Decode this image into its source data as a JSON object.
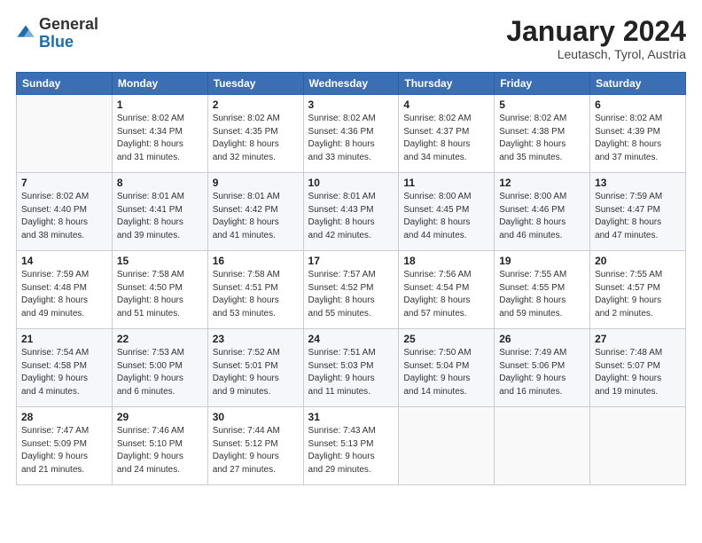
{
  "header": {
    "logo_general": "General",
    "logo_blue": "Blue",
    "month_title": "January 2024",
    "location": "Leutasch, Tyrol, Austria"
  },
  "days_of_week": [
    "Sunday",
    "Monday",
    "Tuesday",
    "Wednesday",
    "Thursday",
    "Friday",
    "Saturday"
  ],
  "weeks": [
    [
      {
        "day": "",
        "detail": ""
      },
      {
        "day": "1",
        "detail": "Sunrise: 8:02 AM\nSunset: 4:34 PM\nDaylight: 8 hours\nand 31 minutes."
      },
      {
        "day": "2",
        "detail": "Sunrise: 8:02 AM\nSunset: 4:35 PM\nDaylight: 8 hours\nand 32 minutes."
      },
      {
        "day": "3",
        "detail": "Sunrise: 8:02 AM\nSunset: 4:36 PM\nDaylight: 8 hours\nand 33 minutes."
      },
      {
        "day": "4",
        "detail": "Sunrise: 8:02 AM\nSunset: 4:37 PM\nDaylight: 8 hours\nand 34 minutes."
      },
      {
        "day": "5",
        "detail": "Sunrise: 8:02 AM\nSunset: 4:38 PM\nDaylight: 8 hours\nand 35 minutes."
      },
      {
        "day": "6",
        "detail": "Sunrise: 8:02 AM\nSunset: 4:39 PM\nDaylight: 8 hours\nand 37 minutes."
      }
    ],
    [
      {
        "day": "7",
        "detail": "Sunrise: 8:02 AM\nSunset: 4:40 PM\nDaylight: 8 hours\nand 38 minutes."
      },
      {
        "day": "8",
        "detail": "Sunrise: 8:01 AM\nSunset: 4:41 PM\nDaylight: 8 hours\nand 39 minutes."
      },
      {
        "day": "9",
        "detail": "Sunrise: 8:01 AM\nSunset: 4:42 PM\nDaylight: 8 hours\nand 41 minutes."
      },
      {
        "day": "10",
        "detail": "Sunrise: 8:01 AM\nSunset: 4:43 PM\nDaylight: 8 hours\nand 42 minutes."
      },
      {
        "day": "11",
        "detail": "Sunrise: 8:00 AM\nSunset: 4:45 PM\nDaylight: 8 hours\nand 44 minutes."
      },
      {
        "day": "12",
        "detail": "Sunrise: 8:00 AM\nSunset: 4:46 PM\nDaylight: 8 hours\nand 46 minutes."
      },
      {
        "day": "13",
        "detail": "Sunrise: 7:59 AM\nSunset: 4:47 PM\nDaylight: 8 hours\nand 47 minutes."
      }
    ],
    [
      {
        "day": "14",
        "detail": "Sunrise: 7:59 AM\nSunset: 4:48 PM\nDaylight: 8 hours\nand 49 minutes."
      },
      {
        "day": "15",
        "detail": "Sunrise: 7:58 AM\nSunset: 4:50 PM\nDaylight: 8 hours\nand 51 minutes."
      },
      {
        "day": "16",
        "detail": "Sunrise: 7:58 AM\nSunset: 4:51 PM\nDaylight: 8 hours\nand 53 minutes."
      },
      {
        "day": "17",
        "detail": "Sunrise: 7:57 AM\nSunset: 4:52 PM\nDaylight: 8 hours\nand 55 minutes."
      },
      {
        "day": "18",
        "detail": "Sunrise: 7:56 AM\nSunset: 4:54 PM\nDaylight: 8 hours\nand 57 minutes."
      },
      {
        "day": "19",
        "detail": "Sunrise: 7:55 AM\nSunset: 4:55 PM\nDaylight: 8 hours\nand 59 minutes."
      },
      {
        "day": "20",
        "detail": "Sunrise: 7:55 AM\nSunset: 4:57 PM\nDaylight: 9 hours\nand 2 minutes."
      }
    ],
    [
      {
        "day": "21",
        "detail": "Sunrise: 7:54 AM\nSunset: 4:58 PM\nDaylight: 9 hours\nand 4 minutes."
      },
      {
        "day": "22",
        "detail": "Sunrise: 7:53 AM\nSunset: 5:00 PM\nDaylight: 9 hours\nand 6 minutes."
      },
      {
        "day": "23",
        "detail": "Sunrise: 7:52 AM\nSunset: 5:01 PM\nDaylight: 9 hours\nand 9 minutes."
      },
      {
        "day": "24",
        "detail": "Sunrise: 7:51 AM\nSunset: 5:03 PM\nDaylight: 9 hours\nand 11 minutes."
      },
      {
        "day": "25",
        "detail": "Sunrise: 7:50 AM\nSunset: 5:04 PM\nDaylight: 9 hours\nand 14 minutes."
      },
      {
        "day": "26",
        "detail": "Sunrise: 7:49 AM\nSunset: 5:06 PM\nDaylight: 9 hours\nand 16 minutes."
      },
      {
        "day": "27",
        "detail": "Sunrise: 7:48 AM\nSunset: 5:07 PM\nDaylight: 9 hours\nand 19 minutes."
      }
    ],
    [
      {
        "day": "28",
        "detail": "Sunrise: 7:47 AM\nSunset: 5:09 PM\nDaylight: 9 hours\nand 21 minutes."
      },
      {
        "day": "29",
        "detail": "Sunrise: 7:46 AM\nSunset: 5:10 PM\nDaylight: 9 hours\nand 24 minutes."
      },
      {
        "day": "30",
        "detail": "Sunrise: 7:44 AM\nSunset: 5:12 PM\nDaylight: 9 hours\nand 27 minutes."
      },
      {
        "day": "31",
        "detail": "Sunrise: 7:43 AM\nSunset: 5:13 PM\nDaylight: 9 hours\nand 29 minutes."
      },
      {
        "day": "",
        "detail": ""
      },
      {
        "day": "",
        "detail": ""
      },
      {
        "day": "",
        "detail": ""
      }
    ]
  ]
}
